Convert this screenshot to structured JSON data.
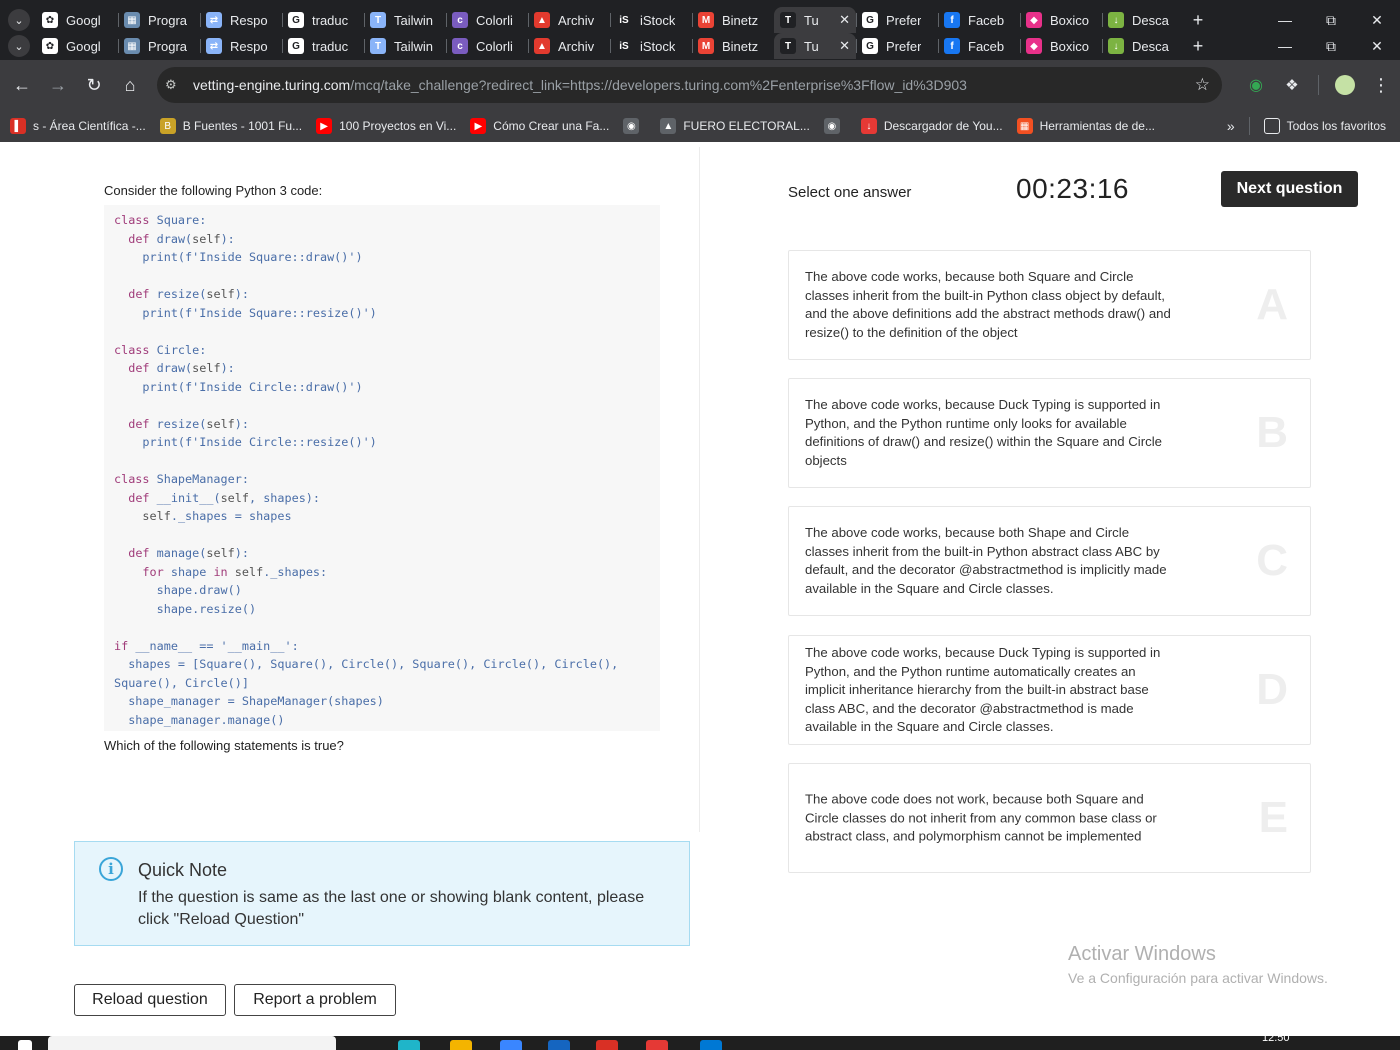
{
  "browser": {
    "tab_rows": [
      [
        {
          "label": "Googl",
          "fav": "chatgpt-icon",
          "color": "#ffffff"
        },
        {
          "label": "Progra",
          "fav": "grid-icon",
          "color": "#6a8caf"
        },
        {
          "label": "Respo",
          "fav": "arrows-icon",
          "color": "#8ab4f8"
        },
        {
          "label": "traduc",
          "fav": "google-icon",
          "color": "#ffffff"
        },
        {
          "label": "Tailwin",
          "fav": "tailwind-icon",
          "color": "#8ab4f8"
        },
        {
          "label": "Colorli",
          "fav": "colorlib-icon",
          "color": "#7a5cbf"
        },
        {
          "label": "Archiv",
          "fav": "archive-icon",
          "color": "#e23a2e"
        },
        {
          "label": "iStock",
          "fav": "istock-icon",
          "color": "#202124"
        },
        {
          "label": "Binetz",
          "fav": "gmail-icon",
          "color": "#ea4335"
        },
        {
          "label": "Tu",
          "fav": "turing-icon",
          "color": "#202124",
          "active": true
        },
        {
          "label": "Prefer",
          "fav": "google-icon",
          "color": "#ffffff"
        },
        {
          "label": "Faceb",
          "fav": "facebook-icon",
          "color": "#1877f2"
        },
        {
          "label": "Boxico",
          "fav": "boxicons-icon",
          "color": "#e8318a"
        },
        {
          "label": "Desca",
          "fav": "download-icon",
          "color": "#7cb342"
        }
      ],
      [
        {
          "label": "Googl",
          "fav": "chatgpt-icon",
          "color": "#ffffff"
        },
        {
          "label": "Progra",
          "fav": "grid-icon",
          "color": "#6a8caf"
        },
        {
          "label": "Respo",
          "fav": "arrows-icon",
          "color": "#8ab4f8"
        },
        {
          "label": "traduc",
          "fav": "google-icon",
          "color": "#ffffff"
        },
        {
          "label": "Tailwin",
          "fav": "tailwind-icon",
          "color": "#8ab4f8"
        },
        {
          "label": "Colorli",
          "fav": "colorlib-icon",
          "color": "#7a5cbf"
        },
        {
          "label": "Archiv",
          "fav": "archive-icon",
          "color": "#e23a2e"
        },
        {
          "label": "iStock",
          "fav": "istock-icon",
          "color": "#202124"
        },
        {
          "label": "Binetz",
          "fav": "gmail-icon",
          "color": "#ea4335"
        },
        {
          "label": "Tu",
          "fav": "turing-icon",
          "color": "#202124",
          "active": true
        },
        {
          "label": "Prefer",
          "fav": "google-icon",
          "color": "#ffffff"
        },
        {
          "label": "Faceb",
          "fav": "facebook-icon",
          "color": "#1877f2"
        },
        {
          "label": "Boxico",
          "fav": "boxicons-icon",
          "color": "#e8318a"
        },
        {
          "label": "Desca",
          "fav": "download-icon",
          "color": "#7cb342"
        }
      ]
    ],
    "url_host": "vetting-engine.turing.com",
    "url_path": "/mcq/take_challenge?redirect_link=https://developers.turing.com%2Fenterprise%3Fflow_id%3D903",
    "bookmarks": [
      {
        "label": "s - Área Científica -...",
        "fav": "bookmark-icon",
        "color": "#d93025"
      },
      {
        "label": "B Fuentes - 1001 Fu...",
        "fav": "fonts-icon",
        "color": "#c9a227"
      },
      {
        "label": "100 Proyectos en Vi...",
        "fav": "youtube-icon",
        "color": "#ff0000"
      },
      {
        "label": "Cómo Crear una Fa...",
        "fav": "youtube-icon",
        "color": "#ff0000"
      },
      {
        "label": "",
        "fav": "globe-icon",
        "color": "#5f6368"
      },
      {
        "label": "FUERO ELECTORAL...",
        "fav": "shield-icon",
        "color": "#5f6368"
      },
      {
        "label": "",
        "fav": "globe-icon",
        "color": "#5f6368"
      },
      {
        "label": "Descargador de You...",
        "fav": "download-icon",
        "color": "#e53935"
      },
      {
        "label": "Herramientas de de...",
        "fav": "windows-icon",
        "color": "#f25022"
      }
    ],
    "bookmarks_more": "»",
    "all_bookmarks": "Todos los favoritos"
  },
  "question": {
    "intro": "Consider the following Python 3 code:",
    "ask": "Which of the following statements is true?",
    "code_lines": [
      "class Square:",
      "  def draw(self):",
      "    print(f'Inside Square::draw()')",
      "",
      "  def resize(self):",
      "    print(f'Inside Square::resize()')",
      "",
      "class Circle:",
      "  def draw(self):",
      "    print(f'Inside Circle::draw()')",
      "",
      "  def resize(self):",
      "    print(f'Inside Circle::resize()')",
      "",
      "class ShapeManager:",
      "  def __init__(self, shapes):",
      "    self._shapes = shapes",
      "",
      "  def manage(self):",
      "    for shape in self._shapes:",
      "      shape.draw()",
      "      shape.resize()",
      "",
      "if __name__ == '__main__':",
      "  shapes = [Square(), Square(), Circle(), Square(), Circle(), Circle(),",
      "Square(), Circle()]",
      "  shape_manager = ShapeManager(shapes)",
      "  shape_manager.manage()"
    ]
  },
  "note": {
    "title": "Quick Note",
    "text": "If the question is same as the last one or showing blank content, please click \"Reload Question\""
  },
  "actions": {
    "reload": "Reload question",
    "report": "Report a problem"
  },
  "answer_panel": {
    "select_label": "Select one answer",
    "timer": "00:23:16",
    "next": "Next question",
    "options": [
      {
        "letter": "A",
        "text": "The above code works, because both Square and Circle classes inherit from the built-in Python class object by default, and the above definitions add the abstract methods draw() and resize() to the definition of the object"
      },
      {
        "letter": "B",
        "text": "The above code works, because Duck Typing is supported in Python, and the Python runtime only looks for available definitions of draw() and resize() within the Square and Circle objects"
      },
      {
        "letter": "C",
        "text": "The above code works, because both Shape and Circle classes inherit from the built-in Python abstract class ABC by default, and the decorator @abstractmethod is implicitly made available in the Square and Circle classes."
      },
      {
        "letter": "D",
        "text": "The above code works, because Duck Typing is supported in Python, and the Python runtime automatically creates an implicit inheritance hierarchy from the built-in abstract base class ABC, and the decorator @abstractmethod is made available in the Square and Circle classes."
      },
      {
        "letter": "E",
        "text": "The above code does not work, because both Square and Circle classes do not inherit from any common base class or abstract class, and polymorphism cannot be implemented"
      }
    ]
  },
  "watermark": {
    "title": "Activar Windows",
    "subtitle": "Ve a Configuración para activar Windows."
  },
  "taskbar": {
    "clock": "12:50"
  },
  "colors": {
    "accent_dark": "#2a2a2a",
    "note_bg": "#e6f5fc",
    "note_border": "#a6dbf1",
    "info_blue": "#3aa5d8"
  }
}
